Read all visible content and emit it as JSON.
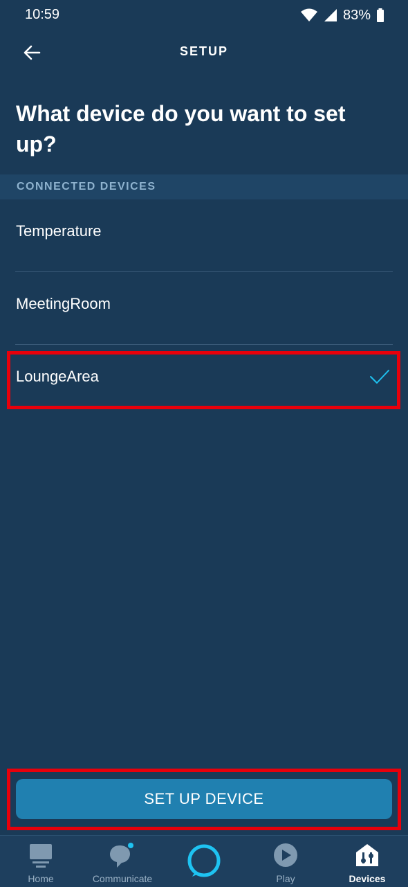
{
  "status_bar": {
    "time": "10:59",
    "battery": "83%"
  },
  "header": {
    "title": "SETUP"
  },
  "page": {
    "title": "What device do you want to set up?"
  },
  "section": {
    "label": "CONNECTED DEVICES"
  },
  "devices": [
    {
      "name": "Temperature",
      "selected": false
    },
    {
      "name": "MeetingRoom",
      "selected": false
    },
    {
      "name": "LoungeArea",
      "selected": true
    }
  ],
  "action": {
    "label": "SET UP DEVICE"
  },
  "nav": {
    "items": [
      {
        "label": "Home",
        "icon": "home-icon"
      },
      {
        "label": "Communicate",
        "icon": "communicate-icon"
      },
      {
        "label": "",
        "icon": "alexa-icon"
      },
      {
        "label": "Play",
        "icon": "play-icon"
      },
      {
        "label": "Devices",
        "icon": "devices-icon",
        "active": true
      }
    ]
  },
  "colors": {
    "background": "#1a3a57",
    "section": "#1f4566",
    "button": "#2080b0",
    "accent": "#1ec3f2",
    "highlight": "#e8000b"
  }
}
